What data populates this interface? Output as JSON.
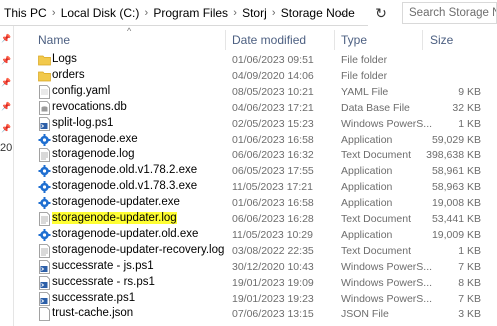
{
  "address": {
    "crumbs": [
      "This PC",
      "Local Disk (C:)",
      "Program Files",
      "Storj",
      "Storage Node"
    ],
    "search_placeholder": "Search Storage Node",
    "left_pane_fragment": "20"
  },
  "columns": {
    "name": "Name",
    "date": "Date modified",
    "type": "Type",
    "size": "Size"
  },
  "files": [
    {
      "name": "Logs",
      "date": "01/06/2023 09:51",
      "type": "File folder",
      "size": "",
      "icon": "folder-icon"
    },
    {
      "name": "orders",
      "date": "04/09/2020 14:06",
      "type": "File folder",
      "size": "",
      "icon": "folder-icon"
    },
    {
      "name": "config.yaml",
      "date": "08/05/2023 10:21",
      "type": "YAML File",
      "size": "9 KB",
      "icon": "document-icon"
    },
    {
      "name": "revocations.db",
      "date": "04/06/2023 17:21",
      "type": "Data Base File",
      "size": "32 KB",
      "icon": "database-icon"
    },
    {
      "name": "split-log.ps1",
      "date": "02/05/2023 15:23",
      "type": "Windows PowerS...",
      "size": "1 KB",
      "icon": "powershell-script-icon"
    },
    {
      "name": "storagenode.exe",
      "date": "01/06/2023 16:58",
      "type": "Application",
      "size": "59,029 KB",
      "icon": "app-gear-icon"
    },
    {
      "name": "storagenode.log",
      "date": "06/06/2023 16:32",
      "type": "Text Document",
      "size": "398,638 KB",
      "icon": "text-file-icon"
    },
    {
      "name": "storagenode.old.v1.78.2.exe",
      "date": "06/05/2023 17:55",
      "type": "Application",
      "size": "58,961 KB",
      "icon": "app-gear-icon"
    },
    {
      "name": "storagenode.old.v1.78.3.exe",
      "date": "11/05/2023 17:21",
      "type": "Application",
      "size": "58,963 KB",
      "icon": "app-gear-icon"
    },
    {
      "name": "storagenode-updater.exe",
      "date": "01/06/2023 16:58",
      "type": "Application",
      "size": "19,008 KB",
      "icon": "app-gear-icon"
    },
    {
      "name": "storagenode-updater.log",
      "date": "06/06/2023 16:28",
      "type": "Text Document",
      "size": "53,441 KB",
      "icon": "text-file-icon",
      "highlight": true
    },
    {
      "name": "storagenode-updater.old.exe",
      "date": "11/05/2023 10:29",
      "type": "Application",
      "size": "19,009 KB",
      "icon": "app-gear-icon"
    },
    {
      "name": "storagenode-updater-recovery.log",
      "date": "03/08/2022 22:35",
      "type": "Text Document",
      "size": "1 KB",
      "icon": "text-file-icon"
    },
    {
      "name": "successrate - js.ps1",
      "date": "30/12/2020 10:43",
      "type": "Windows PowerS...",
      "size": "7 KB",
      "icon": "powershell-script-icon"
    },
    {
      "name": "successrate - rs.ps1",
      "date": "19/01/2023 19:09",
      "type": "Windows PowerS...",
      "size": "8 KB",
      "icon": "powershell-script-icon"
    },
    {
      "name": "successrate.ps1",
      "date": "19/01/2023 19:23",
      "type": "Windows PowerS...",
      "size": "7 KB",
      "icon": "powershell-script-icon"
    },
    {
      "name": "trust-cache.json",
      "date": "07/06/2023 13:15",
      "type": "JSON File",
      "size": "3 KB",
      "icon": "json-file-icon"
    }
  ],
  "colors": {
    "highlight": "#ffff33",
    "header_text": "#4d6082",
    "folder": "#f2c94c",
    "app_gear": "#1f6fd1"
  }
}
